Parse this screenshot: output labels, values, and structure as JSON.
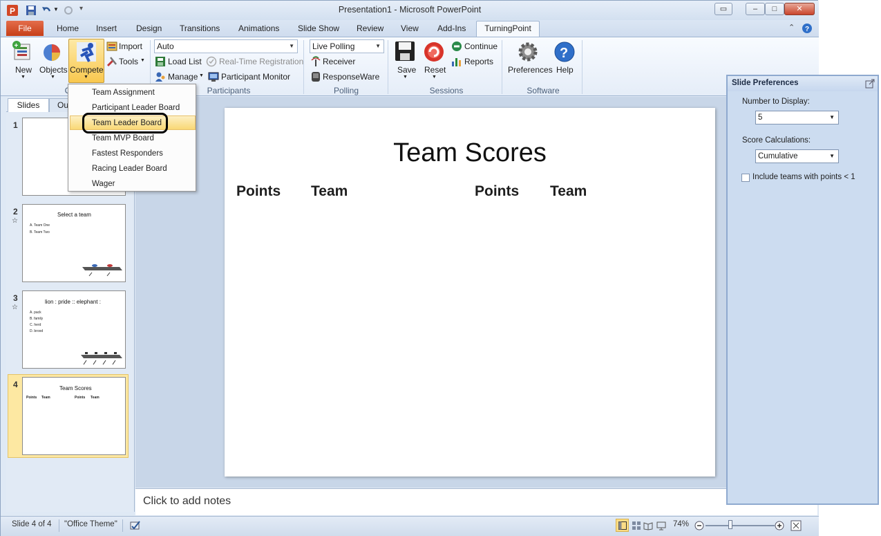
{
  "window": {
    "title": "Presentation1 - Microsoft PowerPoint"
  },
  "tabs": {
    "file": "File",
    "items": [
      "Home",
      "Insert",
      "Design",
      "Transitions",
      "Animations",
      "Slide Show",
      "Review",
      "View",
      "Add-Ins"
    ],
    "active": "TurningPoint"
  },
  "ribbon": {
    "buttons": {
      "new": "New",
      "objects": "Objects",
      "compete": "Compete",
      "import": "Import",
      "tools": "Tools",
      "load_list": "Load List",
      "realtime_registration": "Real-Time Registration",
      "manage": "Manage",
      "participant_monitor": "Participant Monitor",
      "receiver": "Receiver",
      "responseware": "ResponseWare",
      "save": "Save",
      "reset": "Reset",
      "continue": "Continue",
      "reports": "Reports",
      "preferences": "Preferences",
      "help": "Help"
    },
    "dropdowns": {
      "participant_mode": "Auto",
      "polling_mode": "Live Polling"
    },
    "groups": {
      "content_partial": "C",
      "participants": "Participants",
      "polling": "Polling",
      "sessions": "Sessions",
      "software": "Software"
    }
  },
  "compete_menu": {
    "items": [
      "Team Assignment",
      "Participant Leader Board",
      "Team Leader Board",
      "Team MVP Board",
      "Fastest Responders",
      "Racing Leader Board",
      "Wager"
    ],
    "highlighted": "Team Leader Board"
  },
  "left_pane": {
    "tabs": [
      "Slides",
      "Ou"
    ],
    "slides": [
      {
        "number": "1",
        "title": "",
        "items": []
      },
      {
        "number": "2",
        "title": "Select a team",
        "items": [
          "A. Team One",
          "B. Team Two"
        ]
      },
      {
        "number": "3",
        "title": "lion : pride :: elephant :",
        "items": [
          "A. pack",
          "B. family",
          "C. herd",
          "D. brood"
        ]
      },
      {
        "number": "4",
        "title": "Team Scores",
        "items": [
          "Points",
          "Team",
          "Points",
          "Team"
        ]
      }
    ]
  },
  "slide": {
    "title": "Team Scores",
    "col1": "Points",
    "col2": "Team",
    "col3": "Points",
    "col4": "Team"
  },
  "notes": {
    "placeholder": "Click to add notes"
  },
  "statusbar": {
    "slide_info": "Slide 4 of 4",
    "theme": "\"Office Theme\"",
    "zoom": "74%"
  },
  "preferences_panel": {
    "title": "Slide Preferences",
    "number_label": "Number to Display:",
    "number_value": "5",
    "score_label": "Score Calculations:",
    "score_value": "Cumulative",
    "checkbox_label": "Include teams with points < 1",
    "checkbox_checked": false
  },
  "colors": {
    "file_tab": "#c63f18",
    "highlight": "#f9d875",
    "ribbon_bg": "#e5edf8"
  }
}
